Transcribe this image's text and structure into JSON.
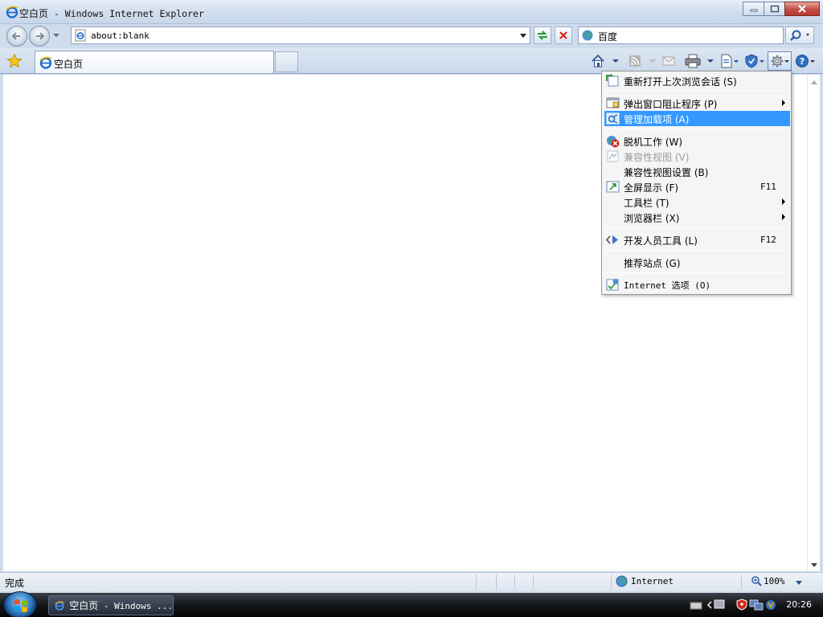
{
  "window": {
    "title_cn": "空白页",
    "title_rest": " - Windows Internet Explorer"
  },
  "navigation": {
    "address": "about:blank",
    "search_provider": "百度"
  },
  "tab": {
    "label": "空白页"
  },
  "tools_menu": {
    "items": [
      {
        "label": "重新打开上次浏览会话",
        "mnemonic": "(S)"
      },
      {
        "label": "弹出窗口阻止程序",
        "mnemonic": "(P)"
      },
      {
        "label": "管理加载项",
        "mnemonic": "(A)"
      },
      {
        "label": "脱机工作",
        "mnemonic": "(W)"
      },
      {
        "label": "兼容性视图",
        "mnemonic": "(V)"
      },
      {
        "label": "兼容性视图设置",
        "mnemonic": "(B)"
      },
      {
        "label": "全屏显示",
        "mnemonic": "(F)",
        "shortcut": "F11"
      },
      {
        "label": "工具栏",
        "mnemonic": "(T)"
      },
      {
        "label": "浏览器栏",
        "mnemonic": "(X)"
      },
      {
        "label": "开发人员工具",
        "mnemonic": "(L)",
        "shortcut": "F12"
      },
      {
        "label": "推荐站点",
        "mnemonic": "(G)"
      },
      {
        "label": "Internet 选项",
        "mnemonic": "(O)"
      }
    ]
  },
  "statusbar": {
    "status": "完成",
    "zone": "Internet",
    "zoom": "100%"
  },
  "taskbar": {
    "window_title_cn": "空白页",
    "window_title_rest": " - Windows ...",
    "clock": "20:26"
  },
  "colors": {
    "menu_highlight": "#3399ff",
    "ie_blue": "#1e6fd0"
  },
  "icons": [
    "ie-icon",
    "back-icon",
    "forward-icon",
    "refresh-icon",
    "stop-icon",
    "search-icon",
    "favorites-star-icon",
    "home-icon",
    "rss-icon",
    "mail-icon",
    "print-icon",
    "page-icon",
    "safety-icon",
    "tools-gear-icon",
    "help-icon",
    "internet-globe-icon",
    "zoom-icon",
    "windows-start-icon"
  ]
}
